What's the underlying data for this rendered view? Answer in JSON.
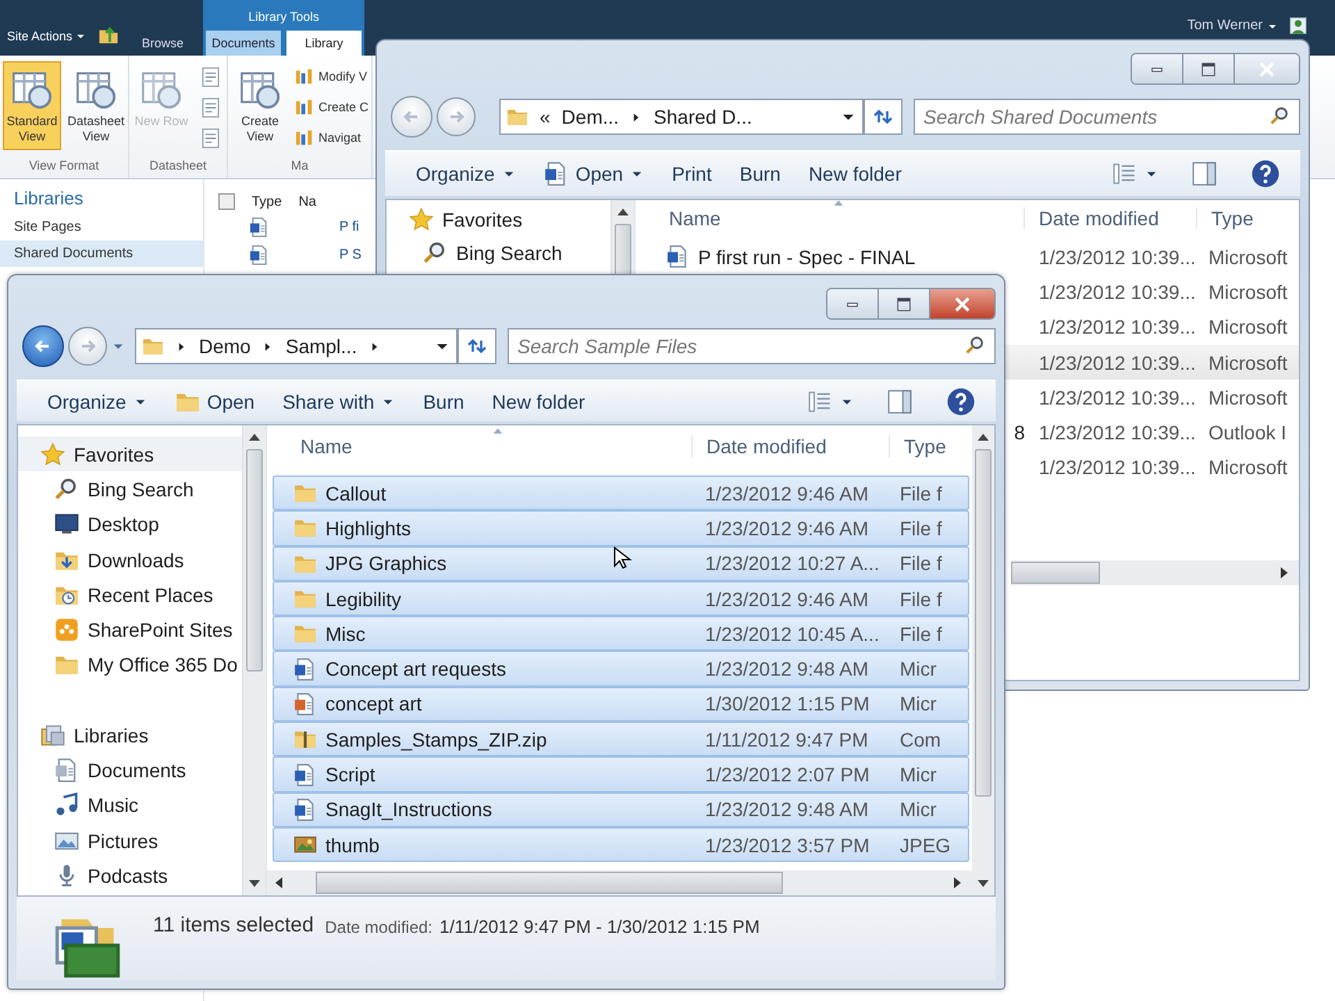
{
  "sharepoint": {
    "site_actions": "Site Actions",
    "context_group": "Library Tools",
    "tabs": [
      {
        "label": "Browse",
        "selected": false,
        "contextual": false
      },
      {
        "label": "Documents",
        "selected": false,
        "contextual": true
      },
      {
        "label": "Library",
        "selected": true,
        "contextual": true
      }
    ],
    "user": "Tom Werner",
    "ribbon_groups": [
      {
        "label": "View Format",
        "buttons": [
          {
            "kind": "large",
            "label": "Standard View",
            "selected": true,
            "disabled": false
          },
          {
            "kind": "large",
            "label": "Datasheet View",
            "selected": false,
            "disabled": false
          }
        ]
      },
      {
        "label": "Datasheet",
        "buttons": [
          {
            "kind": "large",
            "label": "New Row",
            "selected": false,
            "disabled": true
          },
          {
            "kind": "icon"
          },
          {
            "kind": "icon"
          },
          {
            "kind": "icon"
          }
        ]
      },
      {
        "label": "Ma",
        "buttons": [
          {
            "kind": "large",
            "label": "Create View",
            "selected": false,
            "disabled": false
          },
          {
            "kind": "small",
            "label": "Modify V"
          },
          {
            "kind": "small",
            "label": "Create C"
          },
          {
            "kind": "small",
            "label": "Navigat"
          }
        ]
      }
    ],
    "nav_heading": "Libraries",
    "nav_items": [
      {
        "label": "Site Pages",
        "selected": false
      },
      {
        "label": "Shared Documents",
        "selected": true
      }
    ],
    "select_all_checked": false,
    "list_columns": [
      "Type",
      "Na"
    ],
    "list_rows": [
      "P fi",
      "P S"
    ]
  },
  "back_window": {
    "address": [
      {
        "kind": "crumb",
        "label": "«"
      },
      {
        "kind": "crumb",
        "label": "Dem..."
      },
      {
        "kind": "arrow"
      },
      {
        "kind": "crumb",
        "label": "Shared D..."
      }
    ],
    "search": {
      "placeholder": "Search Shared Documents"
    },
    "toolbar": [
      {
        "kind": "menu",
        "label": "Organize"
      },
      {
        "kind": "doc-menu",
        "label": "Open"
      },
      {
        "kind": "plain",
        "label": "Print"
      },
      {
        "kind": "plain",
        "label": "Burn"
      },
      {
        "kind": "plain",
        "label": "New folder"
      }
    ],
    "nav": [
      {
        "label": "Favorites",
        "kind": "star",
        "selected": false,
        "children": [
          {
            "label": "Bing Search",
            "kind": "search",
            "selected": false
          }
        ]
      }
    ],
    "columns": [
      "Name",
      "Date modified",
      "Type"
    ],
    "rows": [
      {
        "name": "P first run - Spec - FINAL",
        "kind": "doc",
        "date": "1/23/2012 10:39...",
        "type": "Microsoft"
      },
      {
        "date": "1/23/2012 10:39...",
        "type": "Microsoft"
      },
      {
        "date": "1/23/2012 10:39...",
        "type": "Microsoft"
      },
      {
        "date": "1/23/2012 10:39...",
        "type": "Microsoft"
      },
      {
        "date": "1/23/2012 10:39...",
        "type": "Microsoft"
      },
      {
        "name": "8",
        "date": "1/23/2012 10:39...",
        "type": "Outlook I"
      },
      {
        "date": "1/23/2012 10:39...",
        "type": "Microsoft"
      }
    ]
  },
  "front_window": {
    "address": [
      {
        "kind": "arrow"
      },
      {
        "kind": "crumb",
        "label": "Demo"
      },
      {
        "kind": "arrow"
      },
      {
        "kind": "crumb",
        "label": "Sampl..."
      },
      {
        "kind": "arrow"
      }
    ],
    "search": {
      "placeholder": "Search Sample Files"
    },
    "toolbar": [
      {
        "kind": "menu",
        "label": "Organize"
      },
      {
        "kind": "folder",
        "label": "Open"
      },
      {
        "kind": "menu",
        "label": "Share with"
      },
      {
        "kind": "plain",
        "label": "Burn"
      },
      {
        "kind": "plain",
        "label": "New folder"
      }
    ],
    "nav": [
      {
        "label": "Favorites",
        "kind": "star",
        "selected": true,
        "children": [
          {
            "label": "Bing Search",
            "kind": "search",
            "selected": false
          },
          {
            "label": "Desktop",
            "kind": "desktop",
            "selected": false
          },
          {
            "label": "Downloads",
            "kind": "downloads",
            "selected": false
          },
          {
            "label": "Recent Places",
            "kind": "places",
            "selected": false
          },
          {
            "label": "SharePoint Sites",
            "kind": "sites",
            "selected": false
          },
          {
            "label": "My Office 365 Do",
            "kind": "folder",
            "selected": false
          }
        ]
      },
      {
        "label": "Libraries",
        "kind": "library",
        "selected": false,
        "children": [
          {
            "label": "Documents",
            "kind": "documents",
            "selected": false
          },
          {
            "label": "Music",
            "kind": "music",
            "selected": false
          },
          {
            "label": "Pictures",
            "kind": "pictures",
            "selected": false
          },
          {
            "label": "Podcasts",
            "kind": "podcasts",
            "selected": false
          }
        ]
      }
    ],
    "columns": [
      "Name",
      "Date modified",
      "Type"
    ],
    "rows": [
      {
        "name": "Callout",
        "kind": "folder",
        "date": "1/23/2012 9:46 AM",
        "type": "File f",
        "selected": true
      },
      {
        "name": "Highlights",
        "kind": "folder",
        "date": "1/23/2012 9:46 AM",
        "type": "File f",
        "selected": true
      },
      {
        "name": "JPG Graphics",
        "kind": "folder",
        "date": "1/23/2012 10:27 A...",
        "type": "File f",
        "selected": true
      },
      {
        "name": "Legibility",
        "kind": "folder",
        "date": "1/23/2012 9:46 AM",
        "type": "File f",
        "selected": true
      },
      {
        "name": "Misc",
        "kind": "folder",
        "date": "1/23/2012 10:45 A...",
        "type": "File f",
        "selected": true
      },
      {
        "name": "Concept art requests",
        "kind": "doc",
        "date": "1/23/2012 9:48 AM",
        "type": "Micr",
        "selected": true
      },
      {
        "name": "concept art",
        "kind": "slides",
        "date": "1/30/2012 1:15 PM",
        "type": "Micr",
        "selected": true
      },
      {
        "name": "Samples_Stamps_ZIP.zip",
        "kind": "zip",
        "date": "1/11/2012 9:47 PM",
        "type": "Com",
        "selected": true
      },
      {
        "name": "Script",
        "kind": "doc",
        "date": "1/23/2012 2:07 PM",
        "type": "Micr",
        "selected": true
      },
      {
        "name": "SnagIt_Instructions",
        "kind": "doc",
        "date": "1/23/2012 9:48 AM",
        "type": "Micr",
        "selected": true
      },
      {
        "name": "thumb",
        "kind": "image",
        "date": "1/23/2012 3:57 PM",
        "type": "JPEG",
        "selected": true
      }
    ],
    "status": {
      "count": "11 items selected",
      "label": "Date modified:",
      "value": "1/11/2012 9:47 PM - 1/30/2012 1:15 PM"
    }
  }
}
